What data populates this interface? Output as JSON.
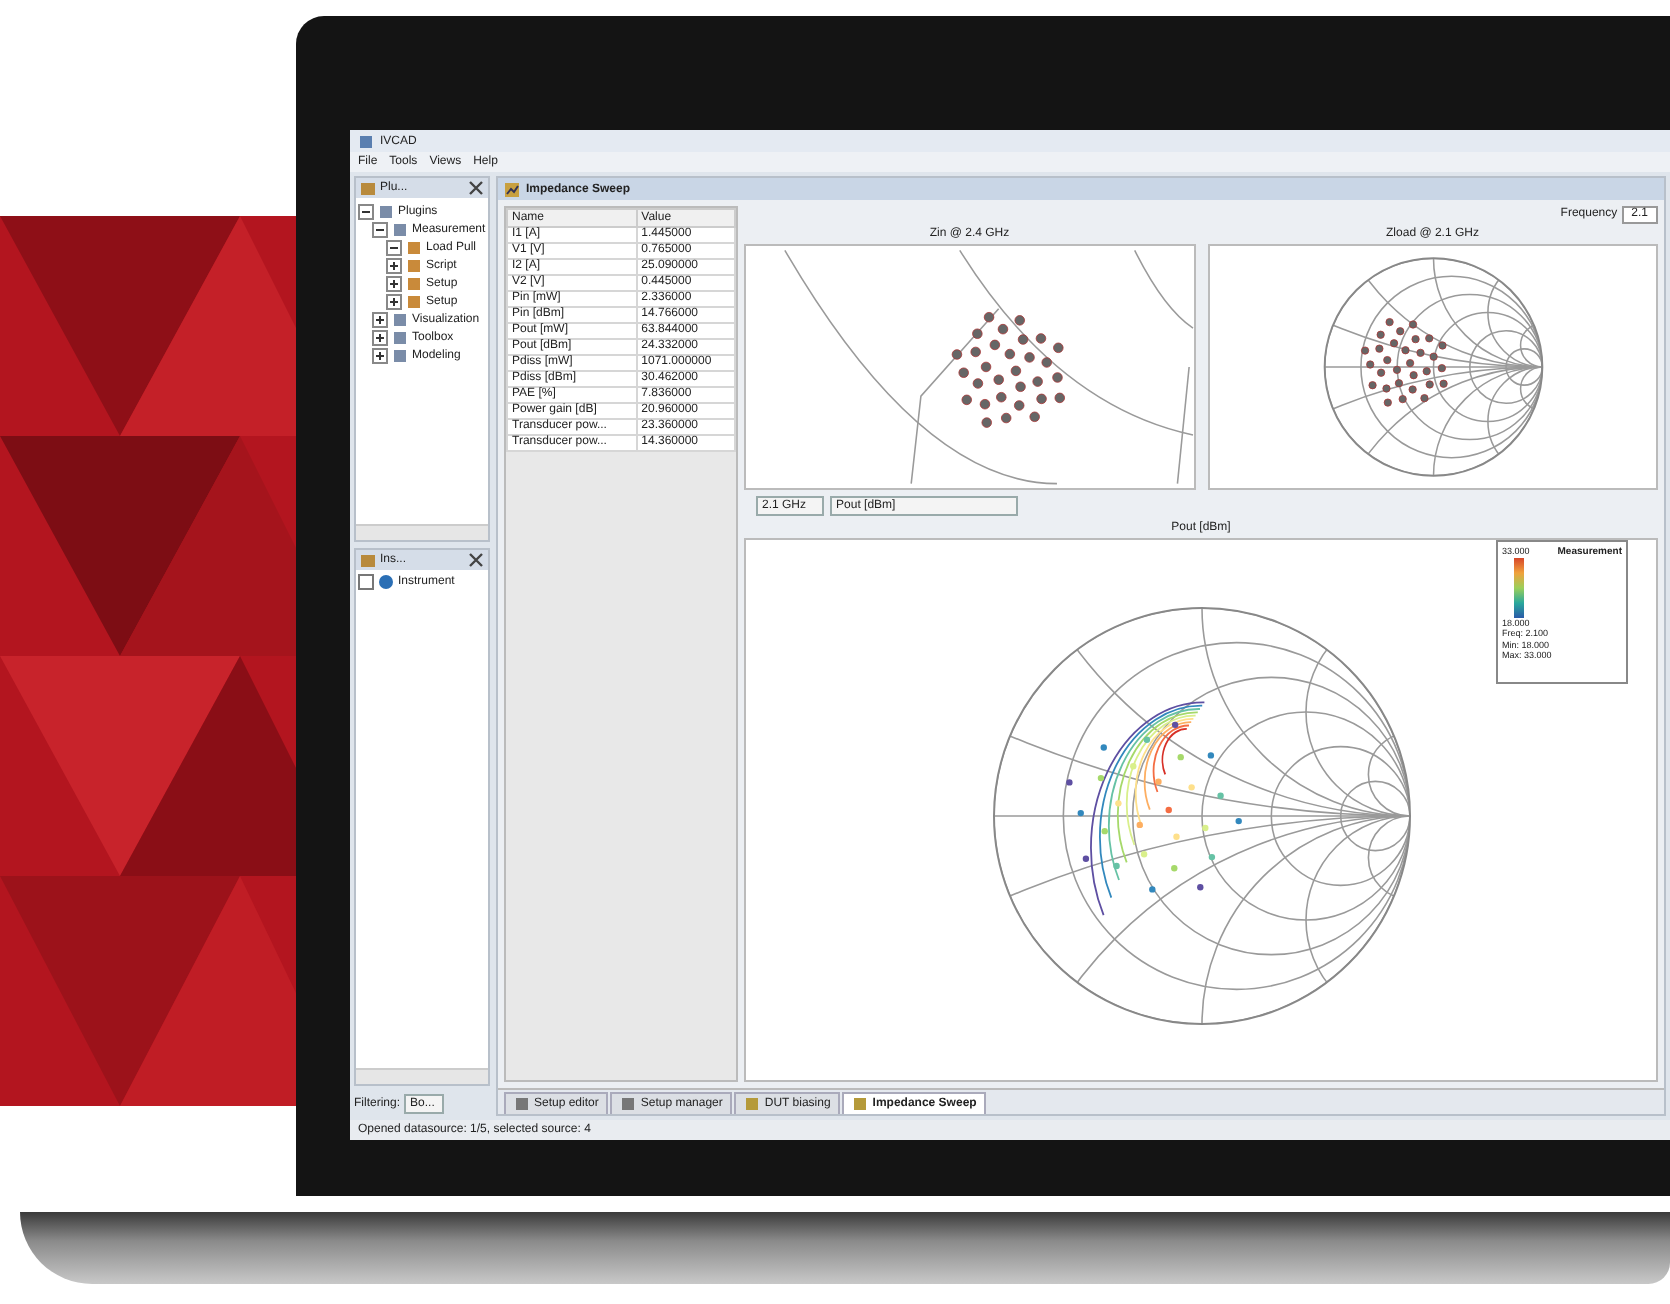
{
  "window": {
    "title": "IVCAD"
  },
  "menu": [
    "File",
    "Tools",
    "Views",
    "Help"
  ],
  "plugins_panel": {
    "title": "Plu...",
    "tree": [
      {
        "label": "Plugins",
        "expanded": true,
        "children": [
          {
            "label": "Measurement",
            "expanded": true,
            "children": [
              {
                "label": "Load Pull",
                "expanded": true
              },
              {
                "label": "Script",
                "expanded": false
              },
              {
                "label": "Setup",
                "expanded": false
              },
              {
                "label": "Setup",
                "expanded": false
              }
            ]
          },
          {
            "label": "Visualization",
            "expanded": false
          },
          {
            "label": "Toolbox",
            "expanded": false
          },
          {
            "label": "Modeling",
            "expanded": false
          }
        ]
      }
    ]
  },
  "instrument_panel": {
    "title": "Ins...",
    "tree": [
      {
        "label": "Instrument",
        "checked": false
      }
    ]
  },
  "filter": {
    "label": "Filtering:",
    "value": "Bo..."
  },
  "document": {
    "title": "Impedance Sweep"
  },
  "table": {
    "columns": [
      "Name",
      "Value"
    ],
    "rows": [
      [
        "I1 [A]",
        "1.445000"
      ],
      [
        "V1 [V]",
        "0.765000"
      ],
      [
        "I2 [A]",
        "25.090000"
      ],
      [
        "V2 [V]",
        "0.445000"
      ],
      [
        "Pin [mW]",
        "2.336000"
      ],
      [
        "Pin [dBm]",
        "14.766000"
      ],
      [
        "Pout [mW]",
        "63.844000"
      ],
      [
        "Pout [dBm]",
        "24.332000"
      ],
      [
        "Pdiss [mW]",
        "1071.000000"
      ],
      [
        "Pdiss [dBm]",
        "30.462000"
      ],
      [
        "PAE [%]",
        "7.836000"
      ],
      [
        "Power gain [dB]",
        "20.960000"
      ],
      [
        "Transducer pow...",
        "23.360000"
      ],
      [
        "Transducer pow...",
        "14.360000"
      ]
    ]
  },
  "frequency": {
    "label": "Frequency",
    "value": "2.1"
  },
  "charts": [
    {
      "title": "Zin @ 2.4 GHz",
      "kind": "zoomed"
    },
    {
      "title": "Zload @ 2.1 GHz",
      "kind": "full"
    }
  ],
  "selectors": [
    {
      "value": "2.1 GHz"
    },
    {
      "value": "Pout [dBm]"
    }
  ],
  "contour": {
    "title": "Pout [dBm]",
    "legend": {
      "title": "Measurement",
      "max_label": "33.000",
      "min_label": "18.000",
      "lines": [
        "Freq: 2.100",
        "Min: 18.000",
        "Max: 33.000"
      ]
    }
  },
  "bottom_tabs": [
    {
      "label": "Setup editor",
      "selected": false
    },
    {
      "label": "Setup manager",
      "selected": false
    },
    {
      "label": "DUT biasing",
      "selected": false
    },
    {
      "label": "Impedance Sweep",
      "selected": true
    }
  ],
  "status_bar": "Opened datasource: 1/5, selected source: 4"
}
